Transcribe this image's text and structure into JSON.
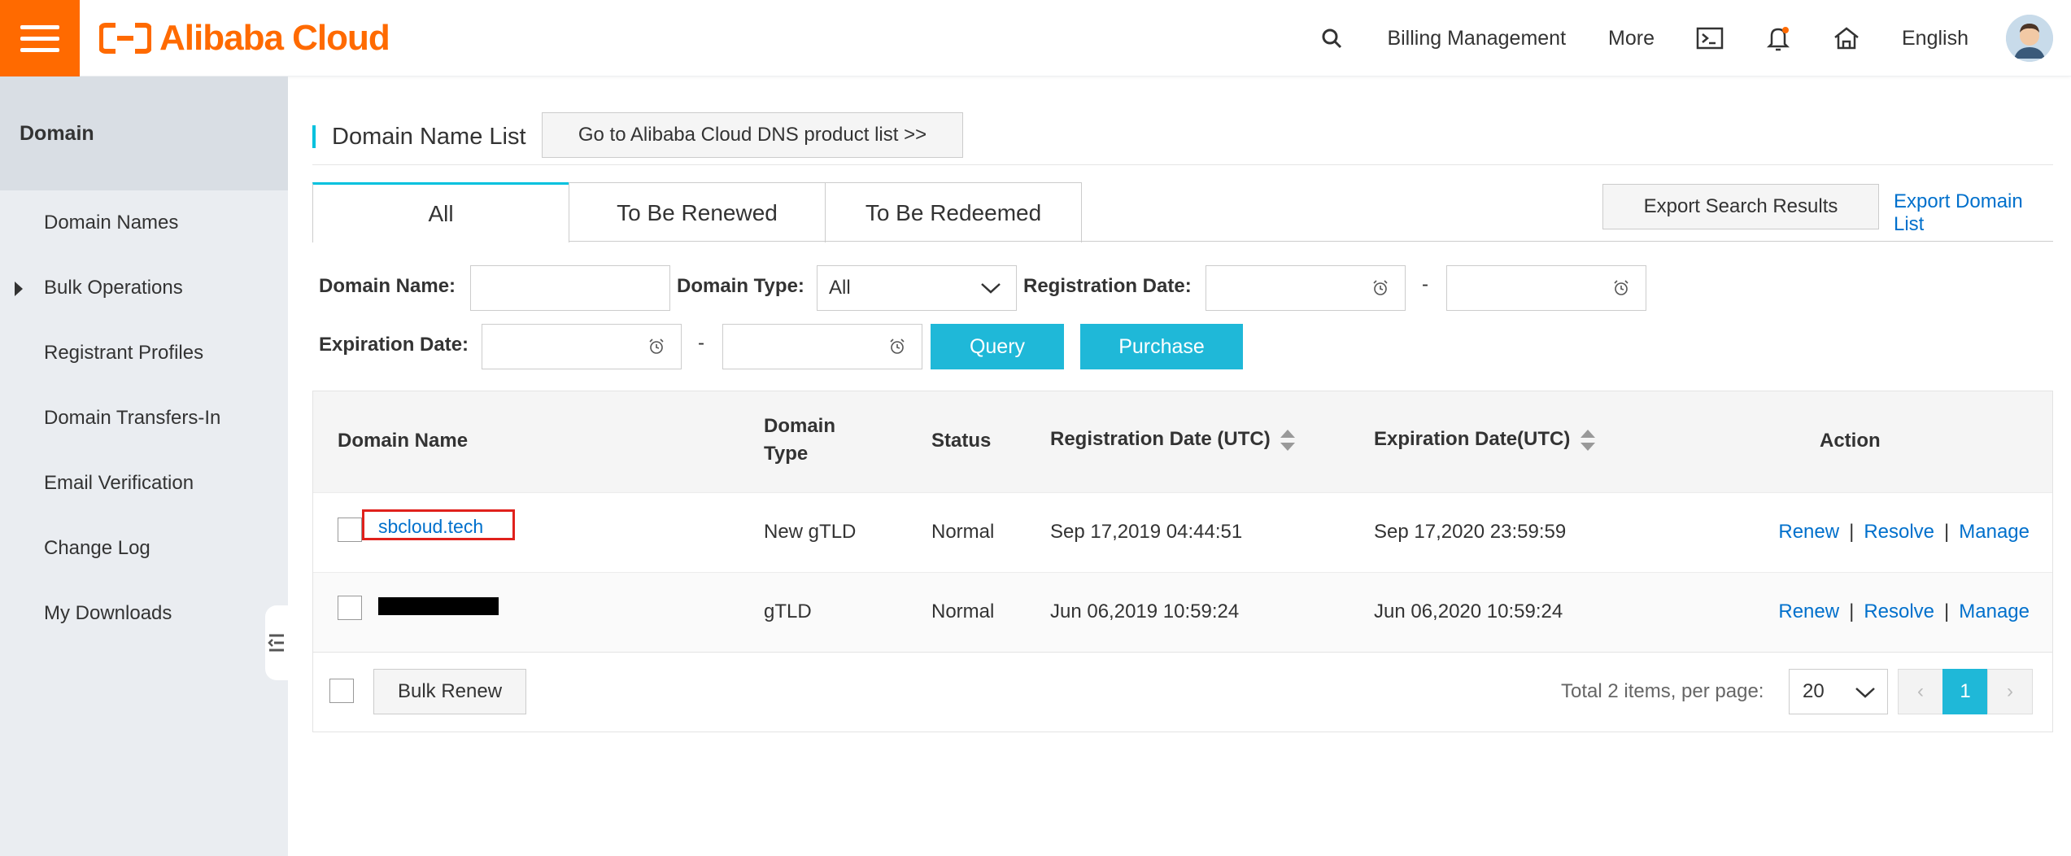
{
  "topbar": {
    "logo_text": "Alibaba Cloud",
    "billing": "Billing Management",
    "more": "More",
    "language": "English",
    "brand_color": "#ff6a00"
  },
  "sidebar": {
    "header": "Domain",
    "items": [
      {
        "label": "Domain Names"
      },
      {
        "label": "Bulk Operations"
      },
      {
        "label": "Registrant Profiles"
      },
      {
        "label": "Domain Transfers-In"
      },
      {
        "label": "Email Verification"
      },
      {
        "label": "Change Log"
      },
      {
        "label": "My Downloads"
      }
    ]
  },
  "main": {
    "title": "Domain Name List",
    "dns_button": "Go to Alibaba Cloud DNS product list >>",
    "tabs": [
      {
        "label": "All"
      },
      {
        "label": "To Be Renewed"
      },
      {
        "label": "To Be Redeemed"
      }
    ],
    "export_search": "Export Search Results",
    "export_list": "Export Domain List",
    "filters": {
      "domain_name_label": "Domain Name:",
      "domain_name_value": "",
      "domain_type_label": "Domain Type:",
      "domain_type_value": "All",
      "reg_date_label": "Registration Date:",
      "dash": "-",
      "exp_date_label": "Expiration Date:",
      "query": "Query",
      "purchase": "Purchase"
    },
    "table": {
      "headers": {
        "domain_name": "Domain Name",
        "domain_type_1": "Domain",
        "domain_type_2": "Type",
        "status": "Status",
        "reg_date": "Registration Date (UTC)",
        "exp_date": "Expiration Date(UTC)",
        "action": "Action"
      },
      "rows": [
        {
          "domain": "sbcloud.tech",
          "type": "New gTLD",
          "status": "Normal",
          "reg": "Sep 17,2019 04:44:51",
          "exp": "Sep 17,2020 23:59:59"
        },
        {
          "domain": "",
          "type": "gTLD",
          "status": "Normal",
          "reg": "Jun 06,2019 10:59:24",
          "exp": "Jun 06,2020 10:59:24"
        }
      ],
      "actions": {
        "renew": "Renew",
        "sep": "|",
        "resolve": "Resolve",
        "manage": "Manage"
      },
      "footer": {
        "bulk_renew": "Bulk Renew",
        "total": "Total 2 items,  per page:",
        "per_page": "20",
        "prev": "‹",
        "current_page": "1",
        "next": "›"
      }
    }
  }
}
